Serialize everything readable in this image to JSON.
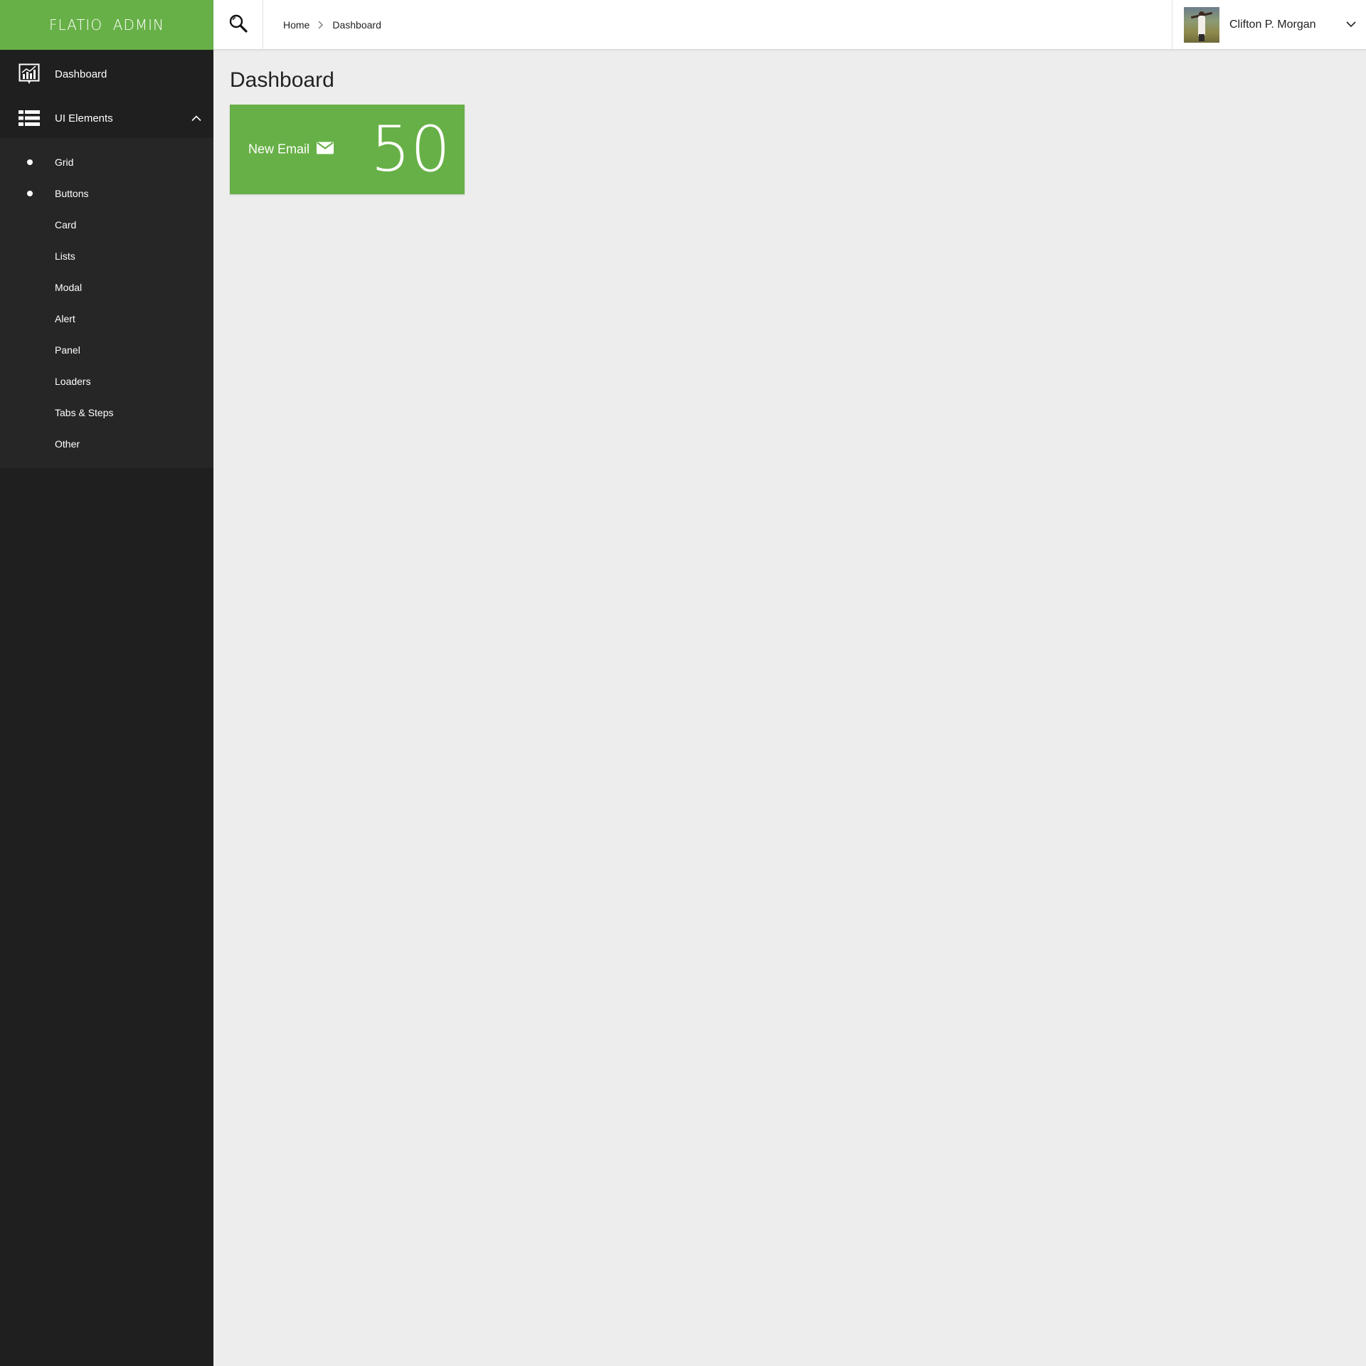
{
  "brand": {
    "title": "FLATIO  ADMIN"
  },
  "sidebar": {
    "items": [
      {
        "label": "Dashboard",
        "icon": "chart-icon"
      },
      {
        "label": "UI Elements",
        "icon": "list-icon",
        "expanded": true
      }
    ],
    "submenu": [
      {
        "label": "Grid",
        "bullet": true
      },
      {
        "label": "Buttons",
        "bullet": true
      },
      {
        "label": "Card",
        "bullet": false
      },
      {
        "label": "Lists",
        "bullet": false
      },
      {
        "label": "Modal",
        "bullet": false
      },
      {
        "label": "Alert",
        "bullet": false
      },
      {
        "label": "Panel",
        "bullet": false
      },
      {
        "label": "Loaders",
        "bullet": false
      },
      {
        "label": "Tabs & Steps",
        "bullet": false
      },
      {
        "label": "Other",
        "bullet": false
      }
    ]
  },
  "header": {
    "search_icon": "search-icon",
    "breadcrumb": [
      "Home",
      "Dashboard"
    ],
    "user": {
      "name": "Clifton P. Morgan"
    }
  },
  "main": {
    "title": "Dashboard",
    "card": {
      "label": "New Email",
      "icon": "envelope-icon",
      "value": "50"
    }
  },
  "colors": {
    "accent": "#67b047",
    "sidebar": "#1f1f1f",
    "submenu": "#262626",
    "background": "#ededed"
  }
}
